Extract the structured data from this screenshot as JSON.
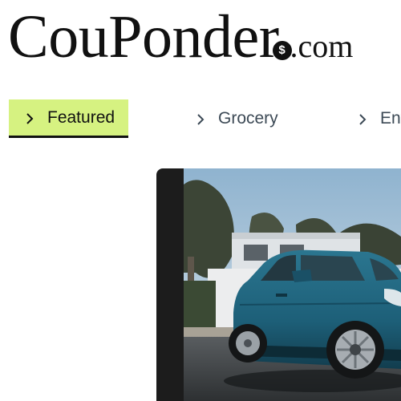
{
  "logo": {
    "main": "CouPonder",
    "badge": "$",
    "tld": ".com"
  },
  "tabs": [
    {
      "label": "Featured",
      "active": true,
      "icon": "chevron-right-icon"
    },
    {
      "label": "Grocery",
      "active": false,
      "icon": "chevron-right-icon"
    },
    {
      "label": "Ent",
      "active": false,
      "icon": "chevron-right-icon"
    }
  ],
  "colors": {
    "active_tab_bg": "#d6f281",
    "tab_text": "#3d4a56",
    "hero_panel": "#1c1c1c",
    "car_body": "#1d5f78"
  },
  "hero": {
    "image": "blue-hatchback-car-photo"
  }
}
